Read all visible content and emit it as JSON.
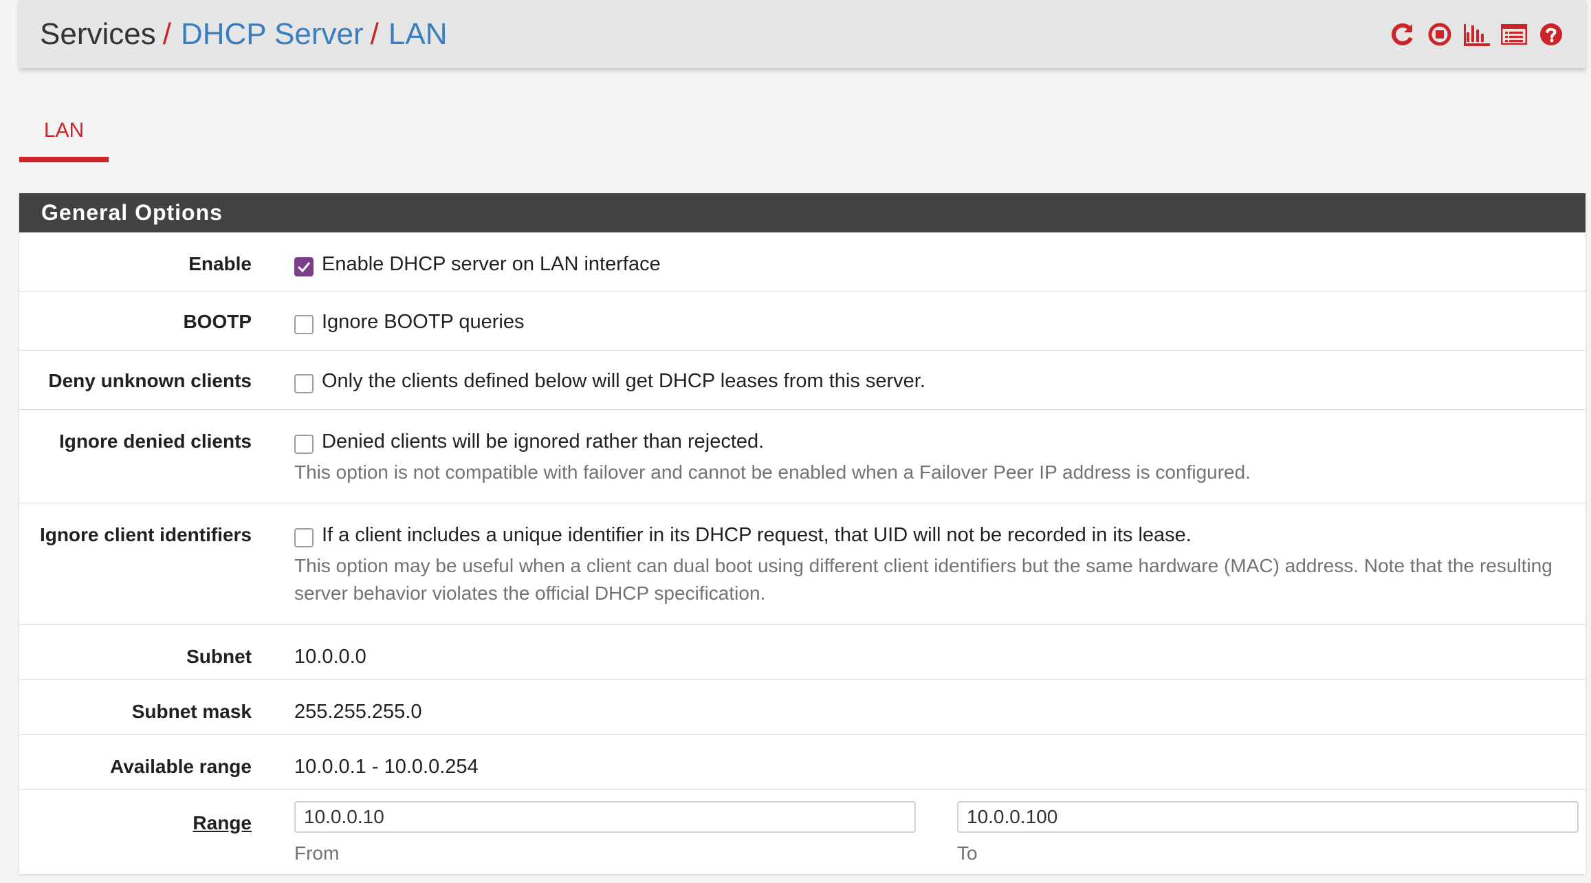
{
  "breadcrumb": {
    "root": "Services",
    "sep1": "/",
    "level2": "DHCP Server",
    "sep2": "/",
    "level3": "LAN"
  },
  "header_icons": [
    "restart-service-icon",
    "stop-service-icon",
    "status-graph-icon",
    "log-list-icon",
    "help-icon"
  ],
  "colors": {
    "accent": "#cc2529",
    "link": "#3a7ebf",
    "heading_bg": "#424242",
    "checkbox_checked": "#7c3d8c"
  },
  "tabs": [
    {
      "label": "LAN",
      "active": true
    }
  ],
  "panel": {
    "title": "General Options"
  },
  "rows": {
    "enable": {
      "label": "Enable",
      "checkbox_text": "Enable DHCP server on LAN interface",
      "checked": true
    },
    "bootp": {
      "label": "BOOTP",
      "checkbox_text": "Ignore BOOTP queries",
      "checked": false
    },
    "deny_unknown": {
      "label": "Deny unknown clients",
      "checkbox_text": "Only the clients defined below will get DHCP leases from this server.",
      "checked": false
    },
    "ignore_denied": {
      "label": "Ignore denied clients",
      "checkbox_text": "Denied clients will be ignored rather than rejected.",
      "help": "This option is not compatible with failover and cannot be enabled when a Failover Peer IP address is configured.",
      "checked": false
    },
    "ignore_client_ids": {
      "label": "Ignore client identifiers",
      "checkbox_text": "If a client includes a unique identifier in its DHCP request, that UID will not be recorded in its lease.",
      "help": "This option may be useful when a client can dual boot using different client identifiers but the same hardware (MAC) address. Note that the resulting server behavior violates the official DHCP specification.",
      "checked": false
    },
    "subnet": {
      "label": "Subnet",
      "value": "10.0.0.0"
    },
    "subnet_mask": {
      "label": "Subnet mask",
      "value": "255.255.255.0"
    },
    "available_range": {
      "label": "Available range",
      "value": "10.0.0.1 - 10.0.0.254"
    },
    "range": {
      "label": "Range",
      "from_value": "10.0.0.10",
      "from_caption": "From",
      "to_value": "10.0.0.100",
      "to_caption": "To"
    }
  }
}
